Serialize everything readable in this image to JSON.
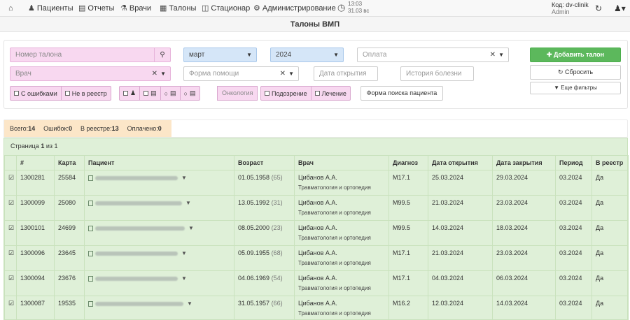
{
  "navbar": {
    "home_icon": "home-icon",
    "items": [
      {
        "label": "Пациенты",
        "icon": "users-icon"
      },
      {
        "label": "Отчеты",
        "icon": "bar-chart-icon"
      },
      {
        "label": "Врачи",
        "icon": "doctor-icon"
      },
      {
        "label": "Талоны",
        "icon": "list-icon"
      },
      {
        "label": "Стационар",
        "icon": "hospital-icon"
      },
      {
        "label": "Администрирование",
        "icon": "gears-icon"
      }
    ],
    "time": "13:03",
    "time_sub": "31.03 вс",
    "user_code": "Код: dv-clinik",
    "user_name": "Admin"
  },
  "page_title": "Талоны ВМП",
  "filters": {
    "ticket_placeholder": "Номер талона",
    "doctor_placeholder": "Врач",
    "month_value": "март",
    "year_value": "2024",
    "payment_placeholder": "Оплата",
    "help_form_placeholder": "Форма помощи",
    "open_date_placeholder": "Дата открытия",
    "history_placeholder": "История болезни",
    "add_button": "Добавить талон",
    "reset_button": "Сбросить",
    "more_filters_button": "Еще фильтры",
    "check_errors": "С ошибками",
    "check_not_registry": "Не в реестр",
    "oncology": "Онкология",
    "check_suspicion": "Подозрение",
    "check_treatment": "Лечение",
    "patient_search_form": "Форма поиска пациента"
  },
  "summary": {
    "total_label": "Всего:",
    "total": "14",
    "errors_label": "Ошибок:",
    "errors": "0",
    "registry_label": "В реестре:",
    "registry": "13",
    "paid_label": "Оплачено:",
    "paid": "0"
  },
  "table": {
    "page_prefix": "Страница",
    "page_current": "1",
    "page_sep": "из",
    "page_total": "1",
    "columns": [
      "#",
      "Карта",
      "Пациент",
      "Возраст",
      "Врач",
      "Диагноз",
      "Дата открытия",
      "Дата закрытия",
      "Период",
      "В реестр"
    ],
    "rows": [
      {
        "num": "1300281",
        "card": "25584",
        "dob": "01.05.1958",
        "age": "(65)",
        "doctor": "Цибанов А.А.",
        "spec": "Травматология и ортопедия",
        "diag": "M17.1",
        "open": "25.03.2024",
        "close": "29.03.2024",
        "period": "03.2024",
        "registry": "Да"
      },
      {
        "num": "1300099",
        "card": "25080",
        "dob": "13.05.1992",
        "age": "(31)",
        "doctor": "Цибанов А.А.",
        "spec": "Травматология и ортопедия",
        "diag": "M99.5",
        "open": "21.03.2024",
        "close": "23.03.2024",
        "period": "03.2024",
        "registry": "Да"
      },
      {
        "num": "1300101",
        "card": "24699",
        "dob": "08.05.2000",
        "age": "(23)",
        "doctor": "Цибанов А.А.",
        "spec": "Травматология и ортопедия",
        "diag": "M99.5",
        "open": "14.03.2024",
        "close": "18.03.2024",
        "period": "03.2024",
        "registry": "Да"
      },
      {
        "num": "1300096",
        "card": "23645",
        "dob": "05.09.1955",
        "age": "(68)",
        "doctor": "Цибанов А.А.",
        "spec": "Травматология и ортопедия",
        "diag": "M17.1",
        "open": "21.03.2024",
        "close": "23.03.2024",
        "period": "03.2024",
        "registry": "Да"
      },
      {
        "num": "1300094",
        "card": "23676",
        "dob": "04.06.1969",
        "age": "(54)",
        "doctor": "Цибанов А.А.",
        "spec": "Травматология и ортопедия",
        "diag": "M17.1",
        "open": "04.03.2024",
        "close": "06.03.2024",
        "period": "03.2024",
        "registry": "Да"
      },
      {
        "num": "1300087",
        "card": "19535",
        "dob": "31.05.1957",
        "age": "(66)",
        "doctor": "Цибанов А.А.",
        "spec": "Травматология и ортопедия",
        "diag": "M16.2",
        "open": "12.03.2024",
        "close": "14.03.2024",
        "period": "03.2024",
        "registry": "Да"
      }
    ]
  }
}
